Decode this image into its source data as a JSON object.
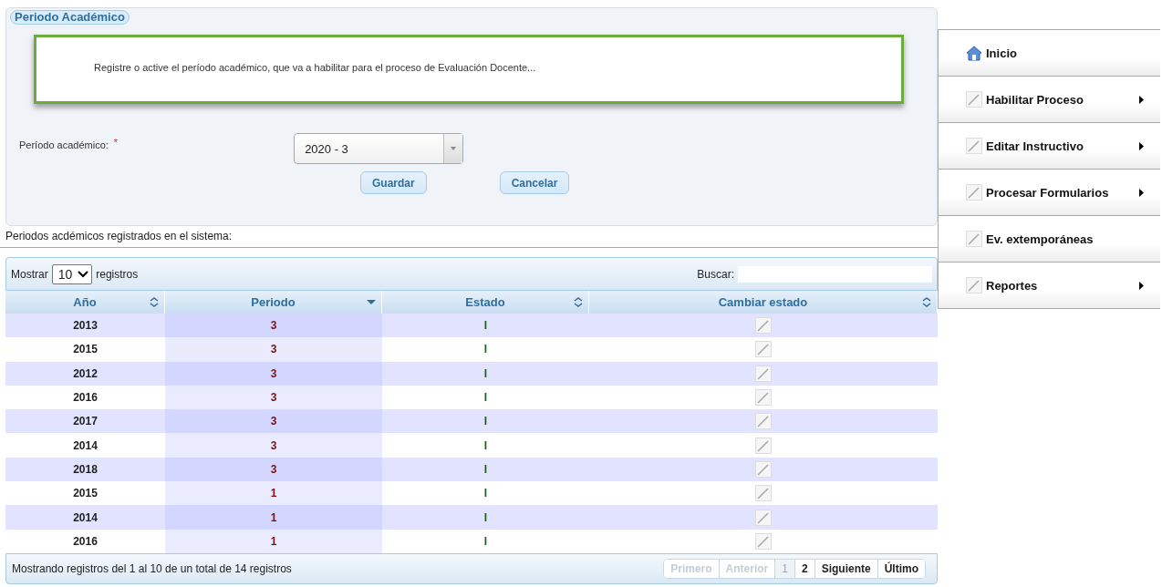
{
  "form": {
    "legend": "Periodo Académico",
    "notice": "Registre o active el período académico, que va a habilitar para el proceso de Evaluación Docente...",
    "field_label": "Período académico:",
    "required_mark": "*",
    "select_value": "2020 - 3",
    "buttons": [
      "Guardar",
      "Cancelar"
    ]
  },
  "list_title": "Periodos acdémicos registrados en el sistema:",
  "table": {
    "length_label_before": "Mostrar",
    "length_value": "10",
    "length_label_after": "registros",
    "search_label": "Buscar:",
    "columns": [
      {
        "label": "Año",
        "sorted": false
      },
      {
        "label": "Periodo",
        "sorted": true
      },
      {
        "label": "Estado",
        "sorted": false
      },
      {
        "label": "Cambiar estado",
        "sorted": false
      }
    ],
    "rows": [
      {
        "year": "2013",
        "period": "3",
        "status": "I"
      },
      {
        "year": "2015",
        "period": "3",
        "status": "I"
      },
      {
        "year": "2012",
        "period": "3",
        "status": "I"
      },
      {
        "year": "2016",
        "period": "3",
        "status": "I"
      },
      {
        "year": "2017",
        "period": "3",
        "status": "I"
      },
      {
        "year": "2014",
        "period": "3",
        "status": "I"
      },
      {
        "year": "2018",
        "period": "3",
        "status": "I"
      },
      {
        "year": "2015",
        "period": "1",
        "status": "I"
      },
      {
        "year": "2014",
        "period": "1",
        "status": "I"
      },
      {
        "year": "2016",
        "period": "1",
        "status": "I"
      }
    ],
    "info": "Mostrando registros del 1 al 10 de un total de 14 registros",
    "pagination": [
      {
        "label": "Primero",
        "disabled": true,
        "selected": false
      },
      {
        "label": "Anterior",
        "disabled": true,
        "selected": false
      },
      {
        "label": "1",
        "disabled": false,
        "selected": true
      },
      {
        "label": "2",
        "disabled": false,
        "selected": false
      },
      {
        "label": "Siguiente",
        "disabled": false,
        "selected": false
      },
      {
        "label": "Último",
        "disabled": false,
        "selected": false
      }
    ]
  },
  "menu": [
    {
      "label": "Inicio",
      "kind": "home",
      "submenu": false
    },
    {
      "label": "Habilitar Proceso",
      "kind": "page",
      "submenu": true
    },
    {
      "label": "Editar Instructivo",
      "kind": "page",
      "submenu": true
    },
    {
      "label": "Procesar Formularios",
      "kind": "page",
      "submenu": true
    },
    {
      "label": "Ev. extemporáneas",
      "kind": "page",
      "submenu": false
    },
    {
      "label": "Reportes",
      "kind": "page",
      "submenu": true
    }
  ]
}
